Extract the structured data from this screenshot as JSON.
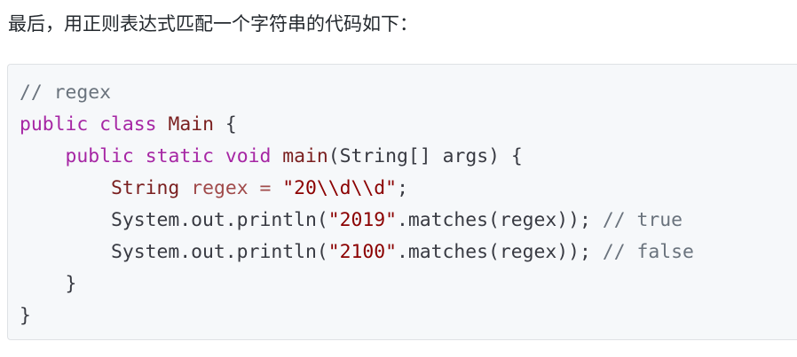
{
  "intro_text": "最后，用正则表达式匹配一个字符串的代码如下：",
  "code": {
    "language": "java",
    "lines": [
      {
        "tokens": [
          {
            "t": "cm",
            "v": "// regex"
          }
        ]
      },
      {
        "tokens": [
          {
            "t": "kw",
            "v": "public"
          },
          {
            "t": "plain",
            "v": " "
          },
          {
            "t": "kw",
            "v": "class"
          },
          {
            "t": "plain",
            "v": " "
          },
          {
            "t": "ty",
            "v": "Main"
          },
          {
            "t": "plain",
            "v": " {"
          }
        ]
      },
      {
        "tokens": [
          {
            "t": "plain",
            "v": "    "
          },
          {
            "t": "kw",
            "v": "public"
          },
          {
            "t": "plain",
            "v": " "
          },
          {
            "t": "kw",
            "v": "static"
          },
          {
            "t": "plain",
            "v": " "
          },
          {
            "t": "kw",
            "v": "void"
          },
          {
            "t": "plain",
            "v": " "
          },
          {
            "t": "fn",
            "v": "main"
          },
          {
            "t": "plain",
            "v": "(String[] args) {"
          }
        ]
      },
      {
        "tokens": [
          {
            "t": "plain",
            "v": "        "
          },
          {
            "t": "ty",
            "v": "String"
          },
          {
            "t": "plain",
            "v": " "
          },
          {
            "t": "var",
            "v": "regex"
          },
          {
            "t": "plain",
            "v": " "
          },
          {
            "t": "var",
            "v": "="
          },
          {
            "t": "plain",
            "v": " "
          },
          {
            "t": "str",
            "v": "\"20\\\\d\\\\d\""
          },
          {
            "t": "plain",
            "v": ";"
          }
        ]
      },
      {
        "tokens": [
          {
            "t": "plain",
            "v": "        System.out.println("
          },
          {
            "t": "str",
            "v": "\"2019\""
          },
          {
            "t": "plain",
            "v": ".matches(regex)); "
          },
          {
            "t": "cm",
            "v": "// true"
          }
        ]
      },
      {
        "tokens": [
          {
            "t": "plain",
            "v": "        System.out.println("
          },
          {
            "t": "str",
            "v": "\"2100\""
          },
          {
            "t": "plain",
            "v": ".matches(regex)); "
          },
          {
            "t": "cm",
            "v": "// false"
          }
        ]
      },
      {
        "tokens": [
          {
            "t": "plain",
            "v": "    }"
          }
        ]
      },
      {
        "tokens": [
          {
            "t": "plain",
            "v": "}"
          }
        ]
      }
    ]
  },
  "colors": {
    "page_background": "#ffffff",
    "code_background": "#f6f8fa",
    "code_border": "#dfe2e5",
    "keyword": "#a626a4",
    "comment": "#6a737d",
    "type": "#7a1f1f",
    "string": "#8b0000",
    "variable": "#a04a4a",
    "text": "#383a42"
  }
}
